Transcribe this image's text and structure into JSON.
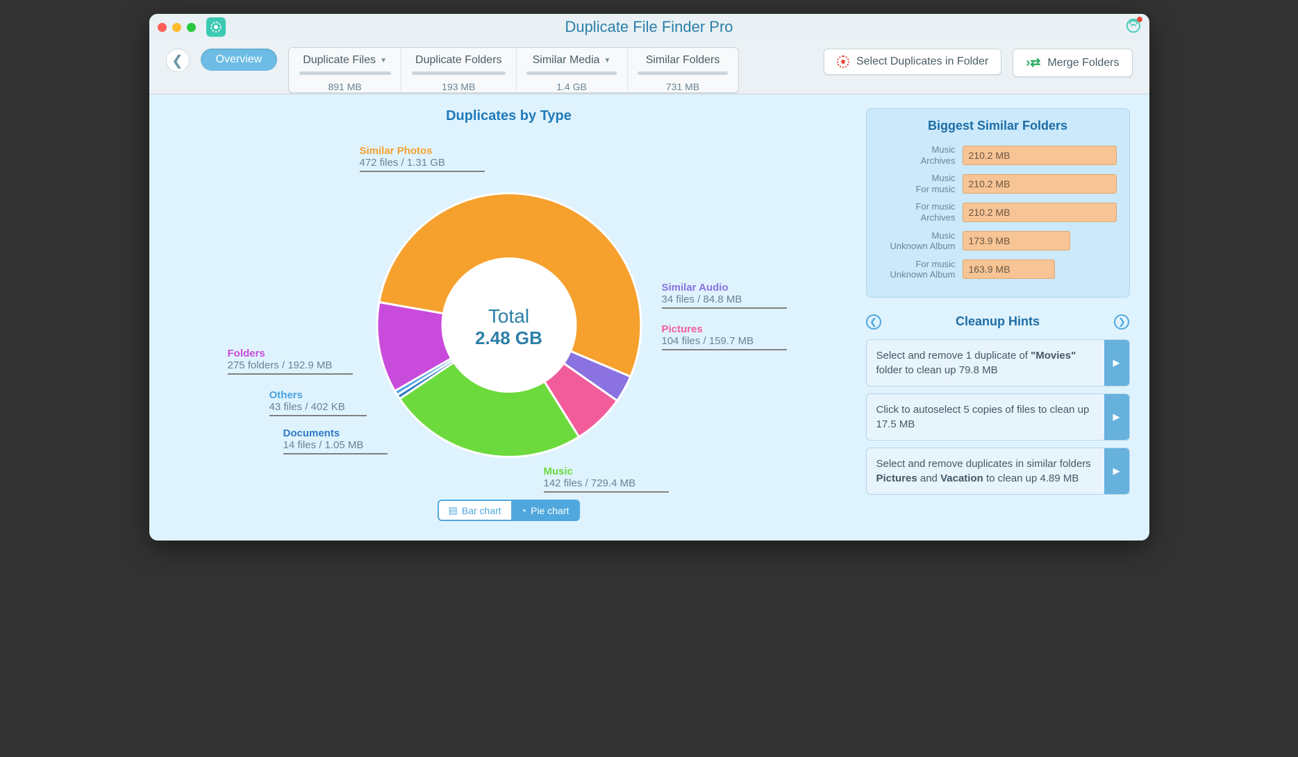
{
  "title": "Duplicate File Finder Pro",
  "toolbar": {
    "overview": "Overview",
    "tabs": [
      {
        "label": "Duplicate Files",
        "chevron": true,
        "size": "891 MB"
      },
      {
        "label": "Duplicate Folders",
        "chevron": false,
        "size": "193 MB"
      },
      {
        "label": "Similar Media",
        "chevron": true,
        "size": "1.4 GB"
      },
      {
        "label": "Similar Folders",
        "chevron": false,
        "size": "731 MB"
      }
    ],
    "select_dups": "Select Duplicates in Folder",
    "merge": "Merge Folders"
  },
  "chart_title": "Duplicates by Type",
  "total_label": "Total",
  "total_value": "2.48 GB",
  "chart_data": {
    "type": "pie",
    "title": "Duplicates by Type",
    "center_label": "Total",
    "center_value": "2.48 GB",
    "series": [
      {
        "name": "Similar Photos",
        "files": 472,
        "unit": "files",
        "size": "1.31 GB",
        "color": "#f6a12e",
        "angle": 193
      },
      {
        "name": "Similar Audio",
        "files": 34,
        "unit": "files",
        "size": "84.8 MB",
        "color": "#8a72e0",
        "angle": 12
      },
      {
        "name": "Pictures",
        "files": 104,
        "unit": "files",
        "size": "159.7 MB",
        "color": "#f35c9a",
        "angle": 23
      },
      {
        "name": "Music",
        "files": 142,
        "unit": "files",
        "size": "729.4 MB",
        "color": "#6cda3c",
        "angle": 88
      },
      {
        "name": "Documents",
        "files": 14,
        "unit": "files",
        "size": "1.05 MB",
        "color": "#2e7bc4",
        "angle": 2
      },
      {
        "name": "Others",
        "files": 43,
        "unit": "files",
        "size": "402 KB",
        "color": "#4aa3e0",
        "angle": 2
      },
      {
        "name": "Folders",
        "files": 275,
        "unit": "folders",
        "size": "192.9 MB",
        "color": "#c94bdb",
        "angle": 40
      }
    ]
  },
  "callouts": {
    "similar_photos": {
      "title": "Similar Photos",
      "sub": "472 files / 1.31 GB"
    },
    "similar_audio": {
      "title": "Similar Audio",
      "sub": "34 files / 84.8 MB"
    },
    "pictures": {
      "title": "Pictures",
      "sub": "104 files / 159.7 MB"
    },
    "music": {
      "title": "Music",
      "sub": "142 files / 729.4 MB"
    },
    "documents": {
      "title": "Documents",
      "sub": "14 files / 1.05 MB"
    },
    "others": {
      "title": "Others",
      "sub": "43 files / 402 KB"
    },
    "folders": {
      "title": "Folders",
      "sub": "275 folders / 192.9 MB"
    }
  },
  "chart_toggle": {
    "bar": "Bar chart",
    "pie": "Pie chart"
  },
  "similar_panel": {
    "title": "Biggest Similar Folders",
    "items": [
      {
        "l1": "Music",
        "l2": "Archives",
        "size": "210.2 MB",
        "pct": 100
      },
      {
        "l1": "Music",
        "l2": "For music",
        "size": "210.2 MB",
        "pct": 100
      },
      {
        "l1": "For music",
        "l2": "Archives",
        "size": "210.2 MB",
        "pct": 100
      },
      {
        "l1": "Music",
        "l2": "Unknown Album",
        "size": "173.9 MB",
        "pct": 70
      },
      {
        "l1": "For music",
        "l2": "Unknown Album",
        "size": "163.9 MB",
        "pct": 60
      }
    ]
  },
  "hints": {
    "title": "Cleanup Hints",
    "items": [
      {
        "pre": "Select and remove 1 duplicate of ",
        "bold": "\"Movies\"",
        "post": " folder to clean up 79.8 MB"
      },
      {
        "pre": "Click to autoselect 5 copies of files to clean up 17.5 MB",
        "bold": "",
        "post": ""
      },
      {
        "pre": "Select and remove duplicates in similar folders ",
        "bold": "Pictures",
        "mid": " and ",
        "bold2": "Vacation",
        "post": " to clean up 4.89 MB"
      }
    ]
  }
}
